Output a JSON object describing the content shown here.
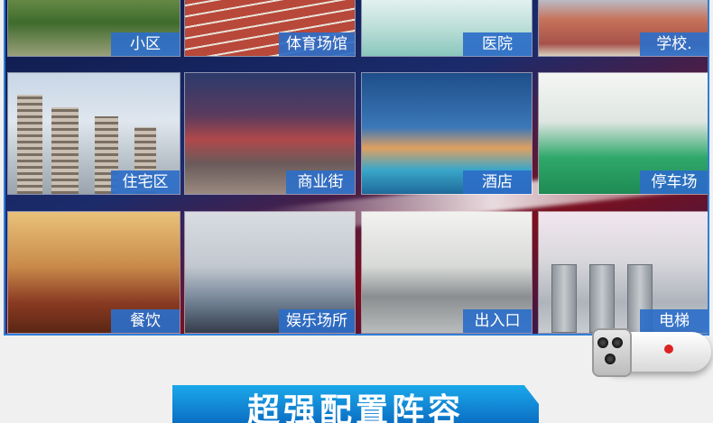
{
  "tiles": [
    {
      "label": "小区",
      "icon": "community-scene"
    },
    {
      "label": "体育场馆",
      "icon": "stadium-scene"
    },
    {
      "label": "医院",
      "icon": "hospital-scene"
    },
    {
      "label": "学校.",
      "icon": "school-scene"
    },
    {
      "label": "住宅区",
      "icon": "residential-scene"
    },
    {
      "label": "商业街",
      "icon": "commercial-street-scene"
    },
    {
      "label": "酒店",
      "icon": "hotel-scene"
    },
    {
      "label": "停车场",
      "icon": "parking-lot-scene"
    },
    {
      "label": "餐饮",
      "icon": "dining-scene"
    },
    {
      "label": "娱乐场所",
      "icon": "entertainment-scene"
    },
    {
      "label": "出入口",
      "icon": "entrance-scene"
    },
    {
      "label": "电梯",
      "icon": "elevator-scene"
    }
  ],
  "banner": {
    "title": "超强配置阵容"
  },
  "colors": {
    "label_bg": "#2c6ec8",
    "panel_border": "#2f7ed8",
    "banner": "#1ba8ea"
  }
}
